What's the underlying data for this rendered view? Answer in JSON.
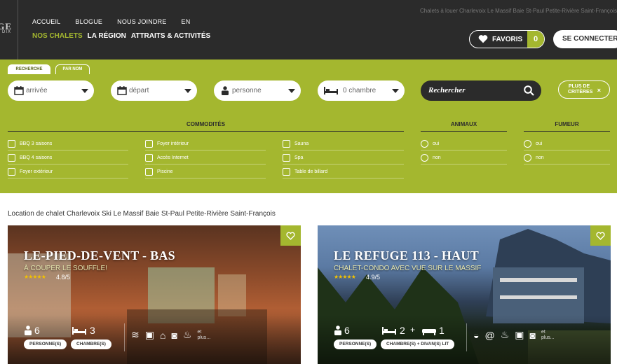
{
  "brand": {
    "logo_lines": [
      "GE",
      "DIX"
    ]
  },
  "header": {
    "tagline": "Chalets à louer Charlevoix Le Massif Baie St-Paul Petite-Rivière Saint-François",
    "top_nav": [
      "ACCUEIL",
      "BLOGUE",
      "NOUS JOINDRE",
      "EN"
    ],
    "main_nav": [
      "NOS CHALETS",
      "LA RÉGION",
      "ATTRAITS & ACTIVITÉS"
    ],
    "favorites_label": "FAVORIS",
    "favorites_count": "0",
    "login_label": "SE CONNECTER"
  },
  "search": {
    "tabs": [
      "RECHERCHE",
      "PAR NOM"
    ],
    "fields": {
      "arrival": "arrivée",
      "departure": "départ",
      "people": "personne",
      "bedrooms": "0 chambre"
    },
    "search_button": "Rechercher",
    "more_criteria": "PLUS DE CRITÈRES",
    "more_criteria_close": "×",
    "sections": {
      "amenities": "COMMODITÉS",
      "animals": "ANIMAUX",
      "smoker": "FUMEUR"
    },
    "amenities_col1": [
      "BBQ 3 saisons",
      "BBQ 4 saisons",
      "Foyer extérieur"
    ],
    "amenities_col2": [
      "Foyer intérieur",
      "Accès Internet",
      "Piscine"
    ],
    "amenities_col3": [
      "Sauna",
      "Spa",
      "Table de billard"
    ],
    "animals_options": [
      "oui",
      "non"
    ],
    "smoker_options": [
      "oui",
      "non"
    ]
  },
  "listing": {
    "heading": "Location de chalet Charlevoix Ski Le Massif Baie St-Paul Petite-Rivière Saint-François",
    "cards": [
      {
        "title": "LE-PIED-DE-VENT - BAS",
        "subtitle": "À COUPER LE SOUFFLE!",
        "stars": "★★★★★",
        "rating": "4.8/5",
        "people": "6",
        "people_label": "PERSONNE(S)",
        "bedrooms": "3",
        "bedrooms_label": "CHAMBRE(S)",
        "more": "et plus..."
      },
      {
        "title": "LE REFUGE 113 - HAUT",
        "subtitle": "CHALET-CONDO AVEC VUE SUR LE MASSIF",
        "stars": "★★★★★",
        "rating": "4.9/5",
        "people": "6",
        "people_label": "PERSONNE(S)",
        "bedrooms": "2",
        "plus_sign": "+",
        "sofabeds": "1",
        "bedrooms_label": "CHAMBRE(S) + DIVAN(S) LIT",
        "more": "et plus..."
      }
    ]
  },
  "colors": {
    "accent": "#a4b72f",
    "dark": "#2b2b2b"
  }
}
